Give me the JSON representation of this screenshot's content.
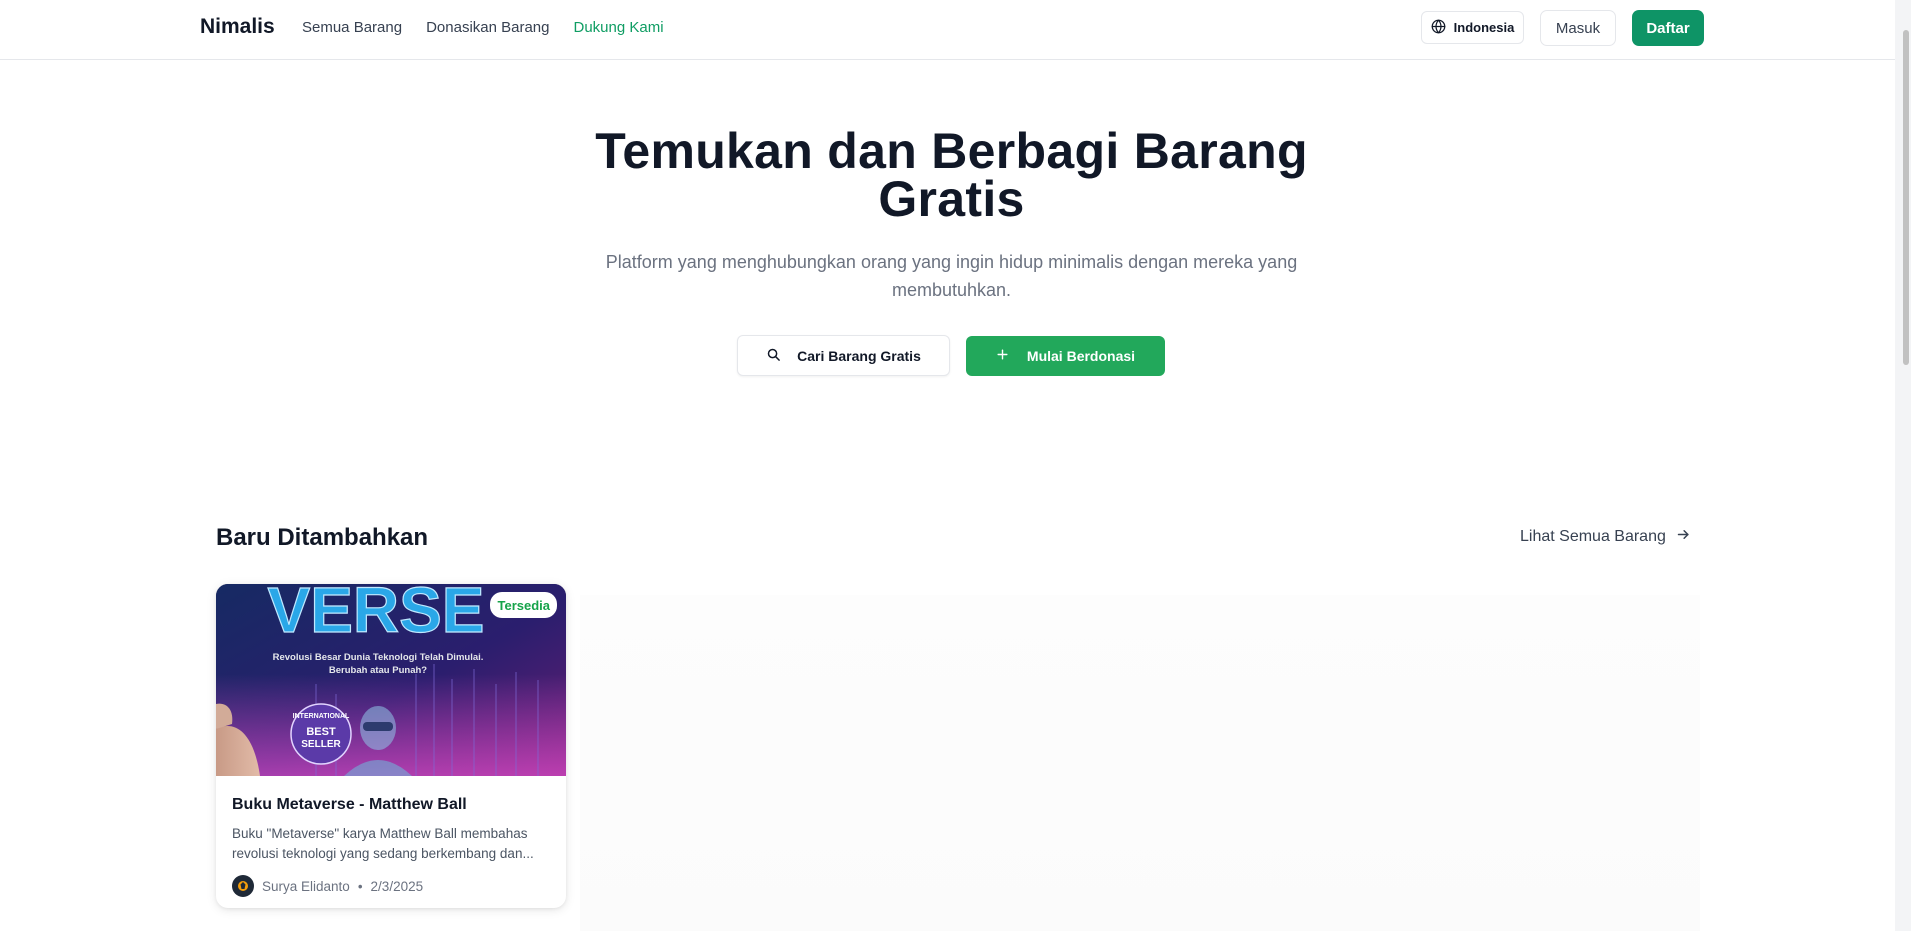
{
  "header": {
    "brand": "Nimalis",
    "nav": [
      {
        "label": "Semua Barang"
      },
      {
        "label": "Donasikan Barang"
      },
      {
        "label": "Dukung Kami"
      }
    ],
    "language": "Indonesia",
    "login_label": "Masuk",
    "signup_label": "Daftar",
    "accent_color": "#0e9466"
  },
  "hero": {
    "title": "Temukan dan Berbagi Barang Gratis",
    "subtitle": "Platform yang menghubungkan orang yang ingin hidup minimalis dengan mereka yang membutuhkan.",
    "search_button": "Cari Barang Gratis",
    "donate_button": "Mulai Berdonasi"
  },
  "recent": {
    "title": "Baru Ditambahkan",
    "see_all": "Lihat Semua Barang",
    "items": [
      {
        "status": "Tersedia",
        "title": "Buku Metaverse - Matthew Ball",
        "description_line1": "Buku \"Metaverse\" karya Matthew Ball membahas",
        "description_line2": "revolusi teknologi yang sedang berkembang dan...",
        "author": "Surya Elidanto",
        "date": "2/3/2025",
        "image": {
          "cover_word": "VERSE",
          "cover_tagline": "Revolusi Besar Dunia Teknologi Telah Dimulai. Berubah atau Punah?",
          "seal_line1": "INTERNATIONAL",
          "seal_line2": "BEST",
          "seal_line3": "SELLER"
        }
      }
    ]
  }
}
